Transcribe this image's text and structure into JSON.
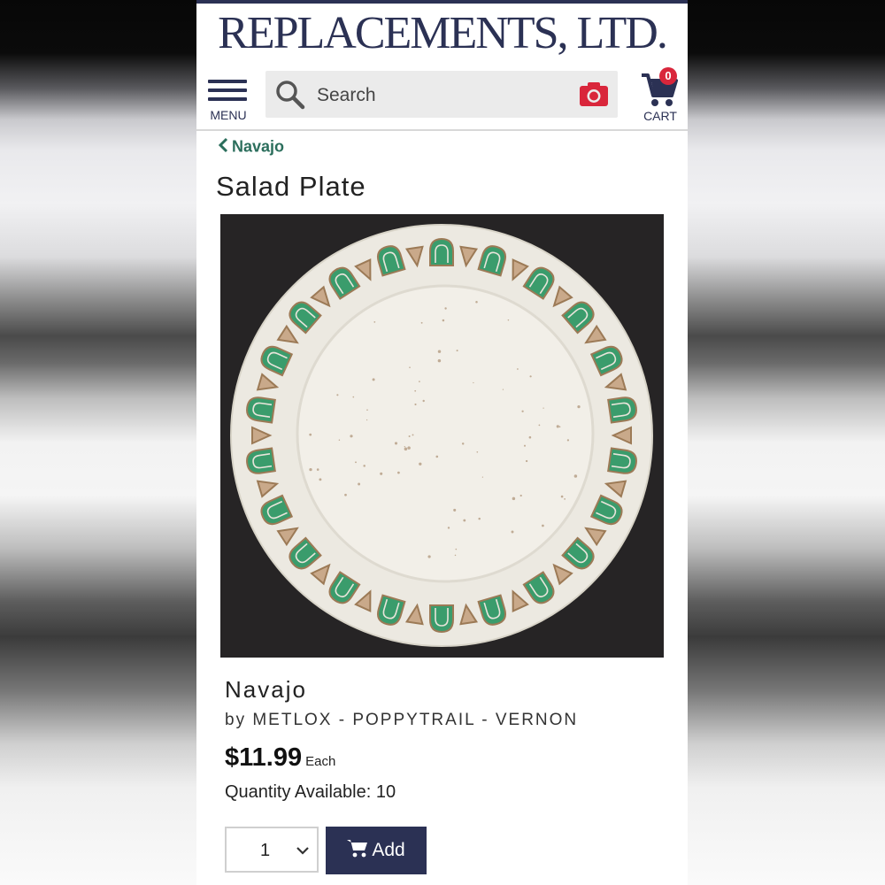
{
  "header": {
    "logo_text": "REPLACEMENTS, LTD.",
    "menu_label": "MENU",
    "search_placeholder": "Search",
    "cart_label": "CART",
    "cart_count": "0"
  },
  "breadcrumb": {
    "label": "Navajo"
  },
  "product": {
    "title": "Salad Plate",
    "pattern": "Navajo",
    "maker": "by METLOX - POPPYTRAIL - VERNON",
    "price": "$11.99",
    "price_unit": "Each",
    "quantity_available": "Quantity Available: 10",
    "quantity_selected": "1",
    "add_label": "Add"
  },
  "colors": {
    "brand_navy": "#2b3154",
    "link_green": "#2b6e5c",
    "badge_red": "#d9263b",
    "plate_green": "#3a9c6c",
    "plate_brown": "#9c7a56"
  }
}
